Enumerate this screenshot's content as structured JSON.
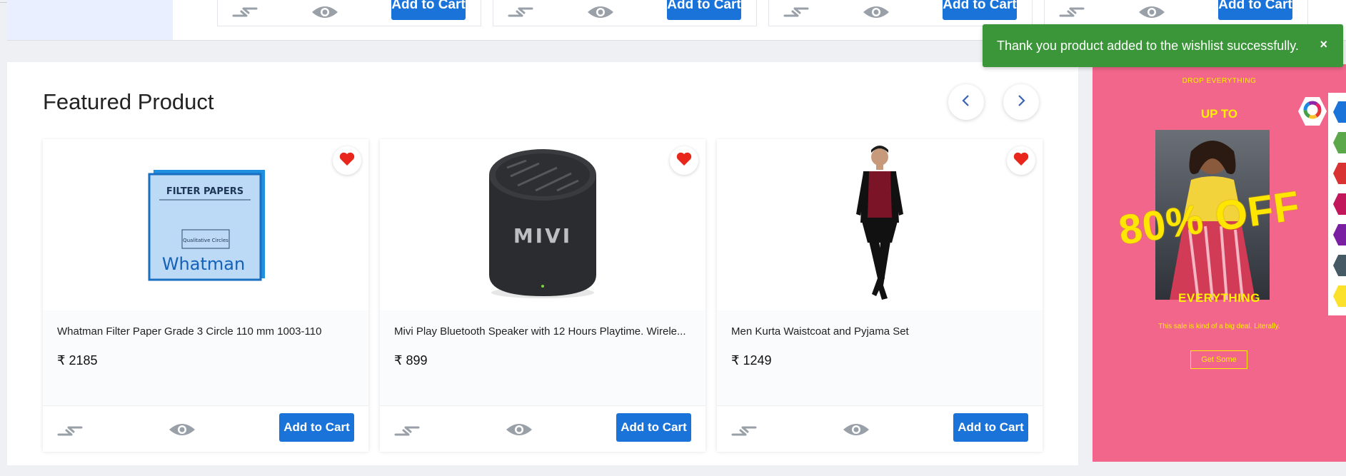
{
  "toast": {
    "message": "Thank you product added to the wishlist successfully.",
    "close_label": "×"
  },
  "top_row": {
    "add_label": "Add to Cart"
  },
  "featured": {
    "title": "Featured Product",
    "products": [
      {
        "name": "Whatman Filter Paper Grade 3 Circle 110 mm 1003-110",
        "price": "₹ 2185",
        "add_label": "Add to Cart",
        "wishlisted": true
      },
      {
        "name": "Mivi Play Bluetooth Speaker with 12 Hours Playtime. Wirele...",
        "price": "₹ 899",
        "add_label": "Add to Cart",
        "wishlisted": true
      },
      {
        "name": "Men Kurta Waistcoat and Pyjama Set",
        "price": "₹ 1249",
        "add_label": "Add to Cart",
        "wishlisted": true
      }
    ]
  },
  "product_images": {
    "filter_box_line1": "FILTER PAPERS",
    "filter_box_line2": "Qualitative Circles",
    "filter_box_brand": "Whatman",
    "speaker_brand": "MIVI"
  },
  "promo": {
    "kicker": "DROP EVERYTHING",
    "up_to": "UP TO",
    "headline": "80% OFF",
    "everything": "EVERYTHING",
    "tagline": "This sale is kind of a big deal. Literally.",
    "cta": "Get Some"
  },
  "colors": {
    "primary": "#1a73d9",
    "toast": "#3a9638",
    "wishlist": "#e8261c",
    "promo_bg": "#f2668b",
    "promo_text": "#fff200",
    "swatches": [
      "#1a73d9",
      "#5ba84a",
      "#d93232",
      "#c2185b",
      "#7b1fa2",
      "#455a64",
      "#fbe02c"
    ]
  }
}
